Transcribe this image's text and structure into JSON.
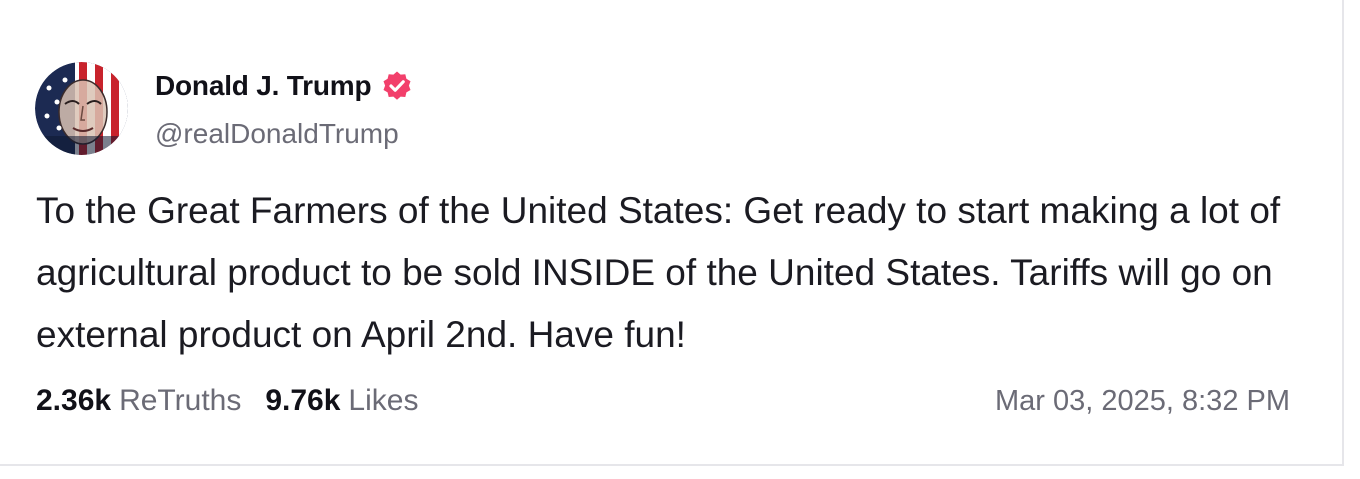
{
  "post": {
    "author": {
      "display_name": "Donald J. Trump",
      "handle": "@realDonaldTrump",
      "verified": true,
      "avatar_icon": "profile-avatar",
      "badge_icon": "verified-badge-icon",
      "badge_color": "#f23f6b"
    },
    "text": "To the Great Farmers of the United States: Get ready to start making a lot of agricultural product to be sold INSIDE of the United States. Tariffs will go on external product on April 2nd. Have fun!",
    "stats": {
      "retruths_count": "2.36k",
      "retruths_label": "ReTruths",
      "likes_count": "9.76k",
      "likes_label": "Likes"
    },
    "timestamp": "Mar 03, 2025, 8:32 PM"
  }
}
